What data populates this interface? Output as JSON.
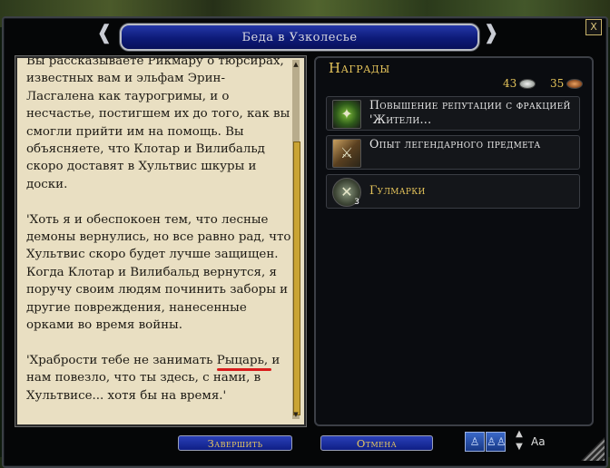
{
  "window": {
    "title": "Беда в Узколесье",
    "close_label": "X"
  },
  "quest_text": {
    "paragraphs": [
      "Вы рассказываете Рикмару о тюрсирах, известных вам и эльфам Эрин-Ласгалена как таурогримы, и о несчастье, постигшем их до того, как вы смогли прийти им на помощь. Вы объясняете, что Клотар и Вилибальд скоро доставят в Хультвис шкуры и доски.",
      "'Хоть я и обеспокоен тем, что лесные демоны вернулись, но все равно рад, что Хультвис скоро будет лучше защищен. Когда Клотар и Вилибальд вернутся, я поручу своим людям починить заборы и другие повреждения, нанесенные орками во время войны."
    ],
    "last_before": "'Храбрости тебе не занимать ",
    "last_highlight": "Рыцарь",
    "last_after": ", и нам повезло, что ты здесь, с нами, в Хультвисе... хотя бы на время.'"
  },
  "rewards": {
    "title": "Награды",
    "currency": {
      "silver": "43",
      "copper": "35"
    },
    "items": [
      {
        "label": "Повышение репутации с фракцией 'Жители...",
        "icon": "reputation-icon"
      },
      {
        "label": "Опыт легендарного предмета",
        "icon": "legendary-item-icon"
      },
      {
        "label": "Гулмарки",
        "icon": "gulmark-icon",
        "count": "3"
      }
    ]
  },
  "buttons": {
    "complete": "Завершить",
    "cancel": "Отмена"
  },
  "font_control": {
    "label": "Aa"
  },
  "colors": {
    "title_bar": "#0d1a78",
    "gold_text": "#e4c35a",
    "parchment": "#e9dfc2",
    "highlight_underline": "#d81c1c"
  }
}
